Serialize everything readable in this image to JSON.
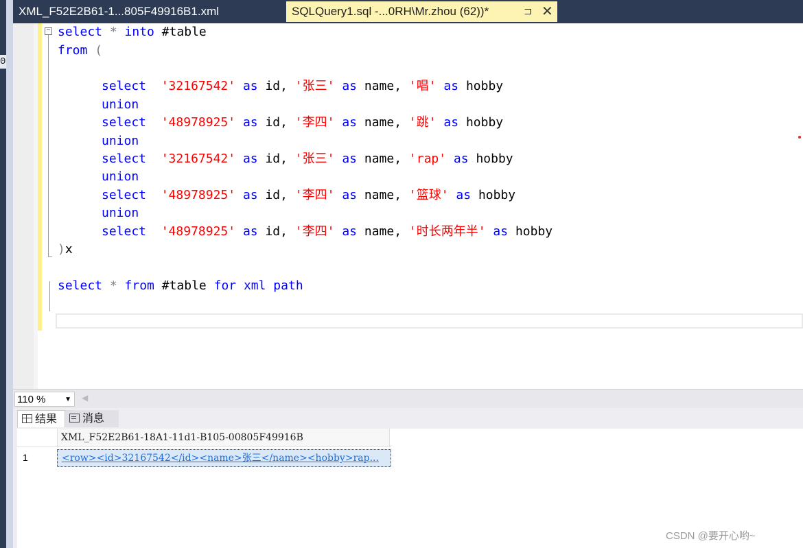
{
  "tabs": {
    "inactive_label": "XML_F52E2B61-1...805F49916B1.xml",
    "active_label": "SQLQuery1.sql -...0RH\\Mr.zhou (62))*",
    "pin_glyph": "⊐",
    "close_glyph": "✕"
  },
  "left_glyph": "0",
  "editor": {
    "outline_toggle": "−",
    "lines": [
      {
        "kw1": "select",
        "g1": " * ",
        "kw2": "into",
        "t1": " #table"
      },
      {
        "kw1": "from",
        "g1": " (",
        "kw2": "",
        "t1": ""
      },
      {
        "sel": "select",
        "id": "'32167542'",
        "as1": "as",
        "c1": " id, ",
        "nm": "'张三'",
        "as2": "as",
        "c2": " name, ",
        "hb": "'唱'",
        "as3": "as",
        "c3": " hobby"
      },
      {
        "u": "union"
      },
      {
        "sel": "select",
        "id": "'48978925'",
        "as1": "as",
        "c1": " id, ",
        "nm": "'李四'",
        "as2": "as",
        "c2": " name, ",
        "hb": "'跳'",
        "as3": "as",
        "c3": " hobby"
      },
      {
        "u": "union"
      },
      {
        "sel": "select",
        "id": "'32167542'",
        "as1": "as",
        "c1": " id, ",
        "nm": "'张三'",
        "as2": "as",
        "c2": " name, ",
        "hb": "'rap'",
        "as3": "as",
        "c3": " hobby"
      },
      {
        "u": "union"
      },
      {
        "sel": "select",
        "id": "'48978925'",
        "as1": "as",
        "c1": " id, ",
        "nm": "'李四'",
        "as2": "as",
        "c2": " name, ",
        "hb": "'篮球'",
        "as3": "as",
        "c3": " hobby"
      },
      {
        "u": "union"
      },
      {
        "sel": "select",
        "id": "'48978925'",
        "as1": "as",
        "c1": " id, ",
        "nm": "'李四'",
        "as2": "as",
        "c2": " name, ",
        "hb": "'时长两年半'",
        "as3": "as",
        "c3": " hobby"
      },
      {
        "close": ")",
        "alias": "x"
      },
      {
        "kw1": "select",
        "g1": " * ",
        "kw2": "from",
        "t1": " #table ",
        "kw3": "for xml path"
      }
    ]
  },
  "zoom": {
    "value": "110 %"
  },
  "results_tabs": {
    "results": "结果",
    "messages": "消息"
  },
  "grid": {
    "column_header": "XML_F52E2B61-18A1-11d1-B105-00805F49916B",
    "rows": [
      {
        "num": "1",
        "value": "<row><id>32167542</id><name>张三</name><hobby>rap..."
      }
    ]
  },
  "watermark": "CSDN @要开心哟~",
  "colors": {
    "keyword": "#0000ff",
    "string": "#ff0000",
    "tab_active": "#fdf4b4",
    "chrome": "#2d3b55"
  }
}
